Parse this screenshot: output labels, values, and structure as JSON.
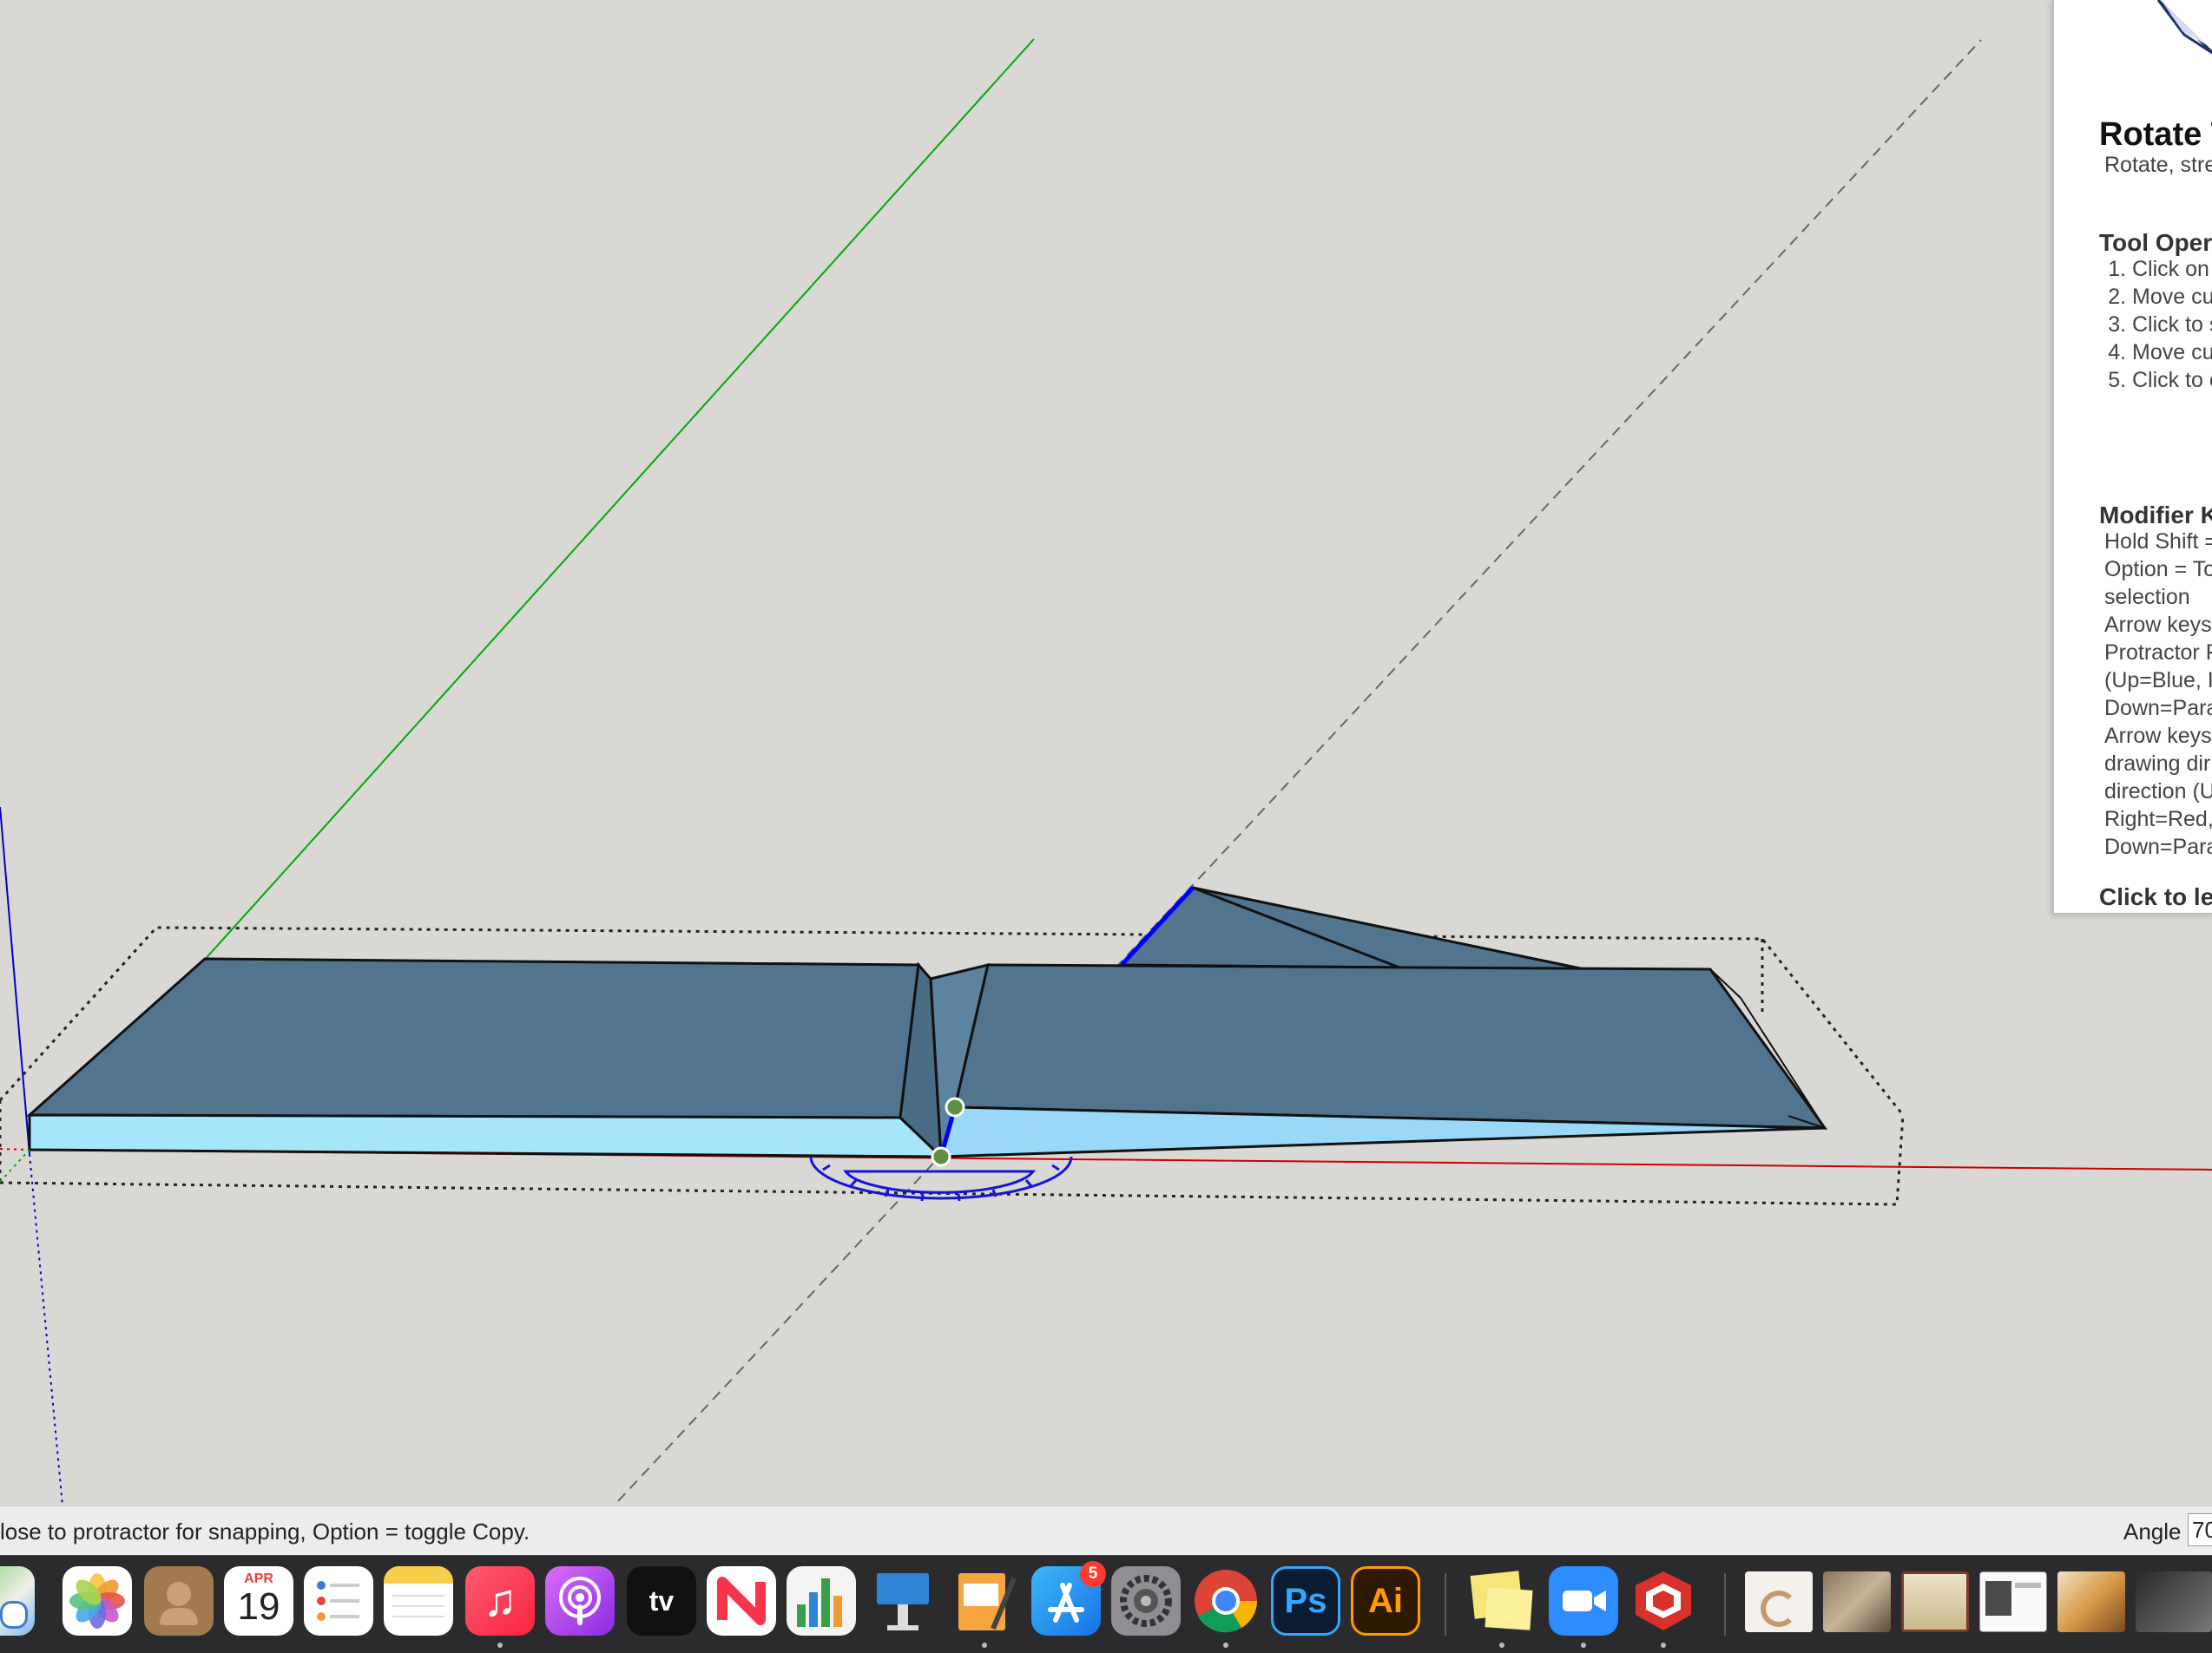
{
  "instructor": {
    "title": "Rotate T",
    "description": "Rotate, stre along a rou",
    "operation_heading": "Tool Opera",
    "steps": [
      "Click on drag first",
      "Move cu staring p",
      "Click to s",
      "Move cu ending p",
      "Click to c"
    ],
    "modifier_heading": "Modifier K",
    "modifier_lines": [
      "Hold Shift =",
      "Option = To",
      "selection",
      "Arrow keys",
      "Protractor F",
      "(Up=Blue, I",
      "Down=Para",
      "Arrow keys",
      "drawing dir",
      "direction (U",
      "Right=Red,",
      "Down=Para"
    ],
    "learn_more": "Click to le"
  },
  "status": {
    "text": "lose to protractor for snapping, Option = toggle Copy.",
    "measure_label": "Angle",
    "measure_value": "70"
  },
  "colors": {
    "background": "#d9d8d5",
    "face_top": "#52758f",
    "face_side": "#a6e6fb",
    "axis_red": "#cc0000",
    "axis_green": "#00aa00",
    "axis_blue": "#0000cc",
    "protractor": "#1515d6",
    "grip": "#5e8f3e"
  },
  "dock": {
    "calendar_month": "APR",
    "calendar_day": "19",
    "tv_label": "tv",
    "ps_label": "Ps",
    "ai_label": "Ai",
    "appstore_badge": "5"
  }
}
